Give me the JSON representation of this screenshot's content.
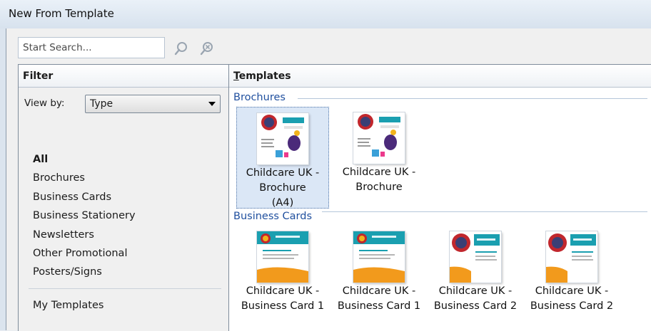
{
  "window": {
    "title": "New From Template"
  },
  "search": {
    "placeholder": "Start Search..."
  },
  "filter": {
    "header": "Filter",
    "view_by_label": "View by:",
    "view_by_value": "Type",
    "items": [
      {
        "label": "All",
        "active": true
      },
      {
        "label": "Brochures"
      },
      {
        "label": "Business Cards"
      },
      {
        "label": "Business Stationery"
      },
      {
        "label": "Newsletters"
      },
      {
        "label": "Other Promotional"
      },
      {
        "label": "Posters/Signs"
      }
    ],
    "my_templates": "My Templates"
  },
  "templates": {
    "header_prefix": "T",
    "header_rest": "emplates",
    "groups": [
      {
        "title": "Brochures",
        "items": [
          {
            "line1": "Childcare UK -",
            "line2": "Brochure",
            "line3": "(A4)",
            "selected": true
          },
          {
            "line1": "Childcare UK -",
            "line2": "Brochure",
            "line3": ""
          }
        ]
      },
      {
        "title": "Business Cards",
        "items": [
          {
            "line1": "Childcare UK -",
            "line2": "Business Card 1"
          },
          {
            "line1": "Childcare UK -",
            "line2": "Business Card 1"
          },
          {
            "line1": "Childcare UK -",
            "line2": "Business Card 2"
          },
          {
            "line1": "Childcare UK -",
            "line2": "Business Card 2"
          }
        ]
      }
    ]
  },
  "colors": {
    "group_header": "#1f4f9e",
    "selection": "#dbe7f6",
    "accent_orange": "#f29a1c",
    "accent_teal": "#1a9fb0"
  },
  "icons": [
    "search-icon",
    "clear-search-icon",
    "dropdown-arrow-icon"
  ]
}
